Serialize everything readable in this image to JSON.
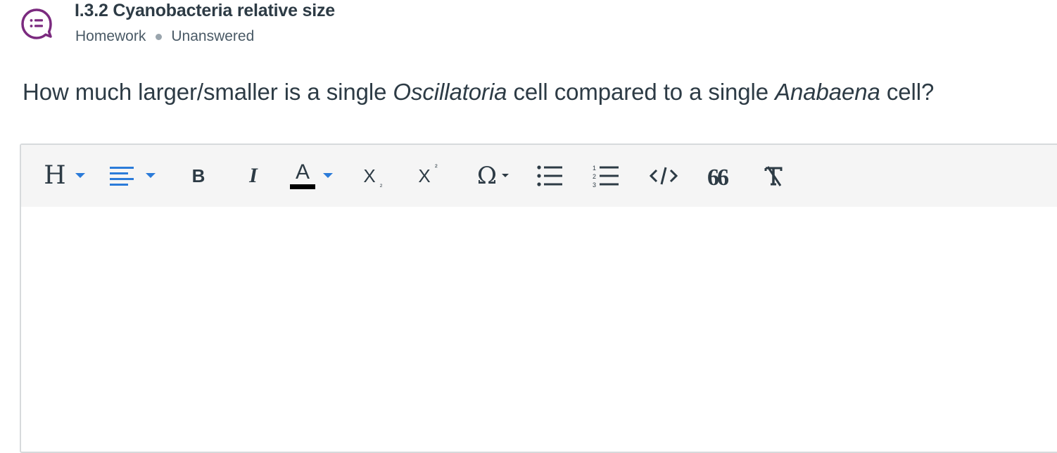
{
  "assignment": {
    "title": "I.3.2 Cyanobacteria relative size",
    "category": "Homework",
    "status": "Unanswered",
    "icon": "discussion-question-icon",
    "accent_color": "#7b2a7f"
  },
  "question": {
    "prefix": "How much larger/smaller is a single ",
    "term1": "Oscillatoria",
    "middle": " cell compared to a single ",
    "term2": "Anabaena",
    "suffix": " cell?"
  },
  "editor": {
    "toolbar": {
      "heading_glyph": "H",
      "bold_glyph": "B",
      "italic_glyph": "I",
      "text_color_glyph": "A",
      "subscript_glyph": "X",
      "superscript_glyph": "X",
      "special_char_glyph": "Ω",
      "quote_glyph": "66",
      "icons": [
        "heading-icon",
        "align-icon",
        "bold-icon",
        "italic-icon",
        "text-color-icon",
        "subscript-icon",
        "superscript-icon",
        "special-character-icon",
        "bullet-list-icon",
        "numbered-list-icon",
        "code-icon",
        "blockquote-icon",
        "clear-formatting-icon"
      ],
      "dropdown_color": "#2b7bd9"
    },
    "content": ""
  }
}
